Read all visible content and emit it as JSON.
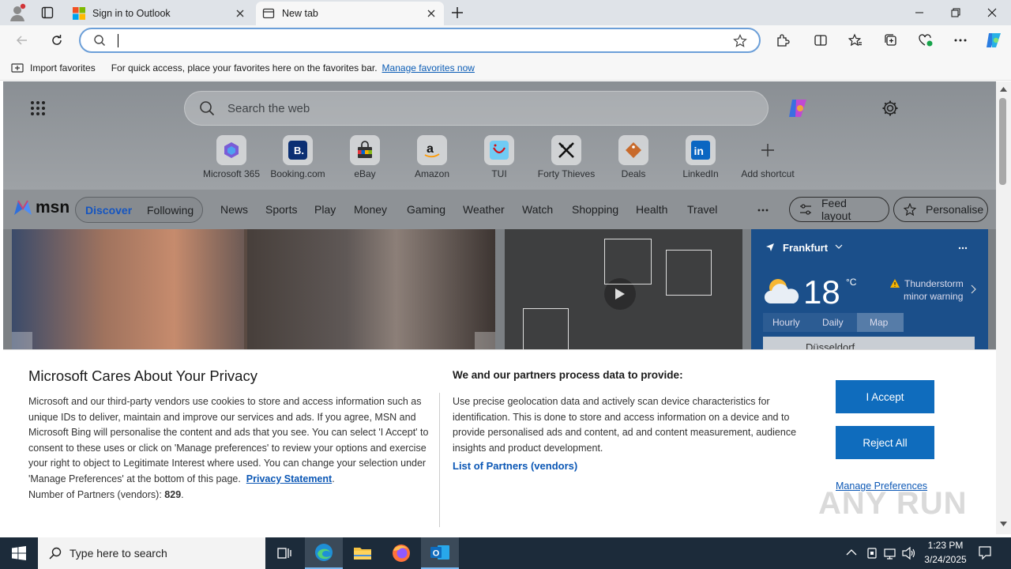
{
  "browser": {
    "tabs": [
      {
        "title": "Sign in to Outlook"
      },
      {
        "title": "New tab"
      }
    ],
    "address": {
      "value": ""
    },
    "favorites_bar": {
      "import_label": "Import favorites",
      "message": "For quick access, place your favorites here on the favorites bar.",
      "manage_link": "Manage favorites now"
    }
  },
  "newtab": {
    "search_placeholder": "Search the web",
    "shortcuts": [
      {
        "label": "Microsoft 365"
      },
      {
        "label": "Booking.com"
      },
      {
        "label": "eBay"
      },
      {
        "label": "Amazon"
      },
      {
        "label": "TUI"
      },
      {
        "label": "Forty Thieves"
      },
      {
        "label": "Deals"
      },
      {
        "label": "LinkedIn"
      },
      {
        "label": "Add shortcut"
      }
    ],
    "brand": "msn",
    "nav": {
      "discover": "Discover",
      "following": "Following",
      "items": [
        "News",
        "Sports",
        "Play",
        "Money",
        "Gaming",
        "Weather",
        "Watch",
        "Shopping",
        "Health",
        "Travel"
      ],
      "feed_layout": "Feed layout",
      "personalise": "Personalise"
    },
    "weather": {
      "location": "Frankfurt",
      "temp": "18",
      "unit": "°C",
      "warning_line1": "Thunderstorm",
      "warning_line2": "minor warning",
      "tabs": [
        "Hourly",
        "Daily",
        "Map"
      ],
      "map_city": "Düsseldorf"
    }
  },
  "privacy": {
    "title": "Microsoft Cares About Your Privacy",
    "body": "Microsoft and our third-party vendors use cookies to store and access information such as unique IDs to deliver, maintain and improve our services and ads. If you agree, MSN and Microsoft Bing will personalise the content and ads that you see. You can select 'I Accept' to consent to these uses or click on 'Manage preferences' to review your options and exercise your right to object to Legitimate Interest where used.  You can change your selection under 'Manage Preferences' at the bottom of this page.",
    "statement_link": "Privacy Statement",
    "partners_label": "Number of Partners (vendors):",
    "partners_count": "829",
    "right_title": "We and our partners process data to provide:",
    "right_body": "Use precise geolocation data and actively scan device characteristics for identification. This is done to store and access information on a device and to provide personalised ads and content, ad and content measurement, audience insights and product development.",
    "partners_link": "List of Partners (vendors)",
    "accept": "I Accept",
    "reject": "Reject All",
    "manage": "Manage Preferences"
  },
  "taskbar": {
    "search_placeholder": "Type here to search",
    "time": "1:23 PM",
    "date": "3/24/2025"
  },
  "watermark": "ANY RUN"
}
